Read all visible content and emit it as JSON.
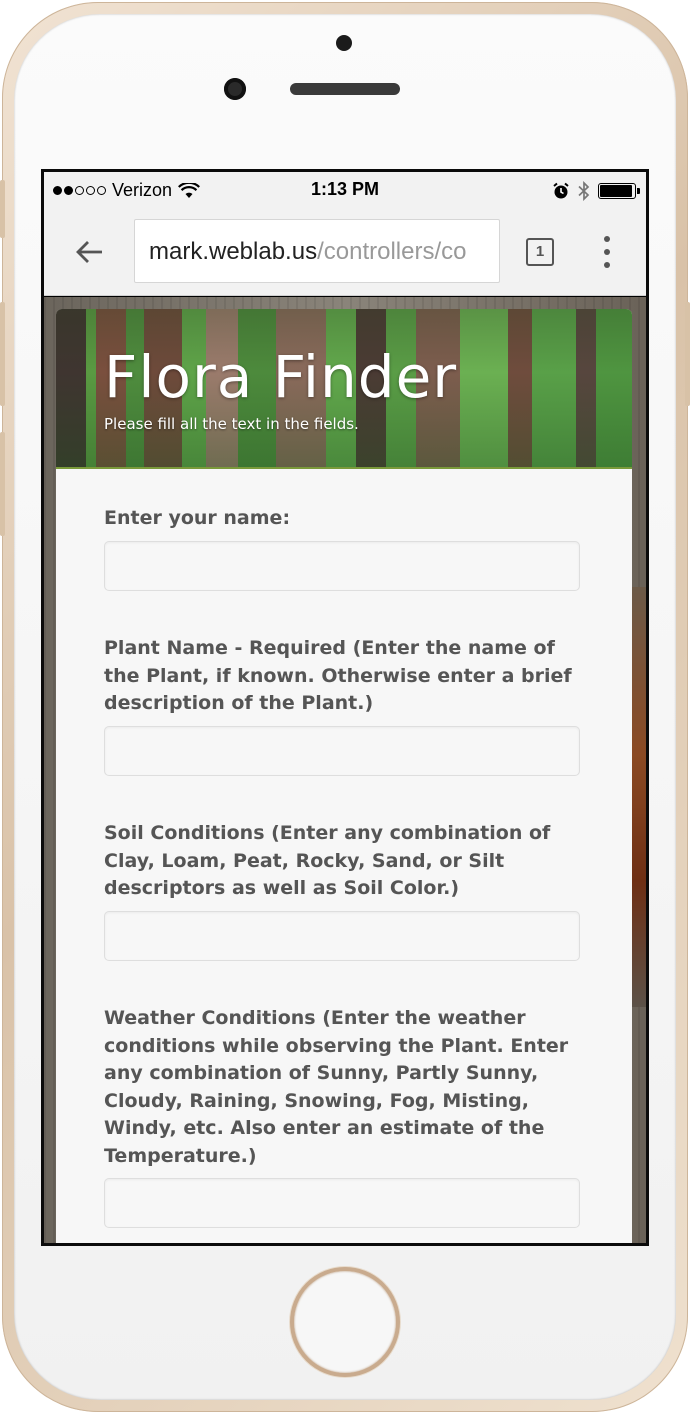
{
  "status_bar": {
    "carrier": "Verizon",
    "signal_bars_filled": 2,
    "signal_bars_total": 5,
    "time": "1:13 PM",
    "battery_level": 0.95
  },
  "browser": {
    "url_host": "mark.weblab.us",
    "url_path": "/controllers/co",
    "tab_count": "1"
  },
  "hero": {
    "title": "Flora Finder",
    "subtitle": "Please fill all the text in the fields."
  },
  "form": {
    "fields": [
      {
        "label": "Enter your name:",
        "value": ""
      },
      {
        "label": "Plant Name - Required (Enter the name of the Plant, if known. Otherwise enter a brief description of the Plant.)",
        "value": ""
      },
      {
        "label": "Soil Conditions (Enter any combination of Clay, Loam, Peat, Rocky, Sand, or Silt descriptors as well as Soil Color.)",
        "value": ""
      },
      {
        "label": "Weather Conditions (Enter the weather conditions while observing the Plant. Enter any combination of Sunny, Partly Sunny, Cloudy, Raining, Snowing, Fog, Misting, Windy, etc. Also enter an estimate of the Temperature.)",
        "value": ""
      }
    ]
  },
  "colors": {
    "label_text": "#555555",
    "hero_accent": "#7a9a3a",
    "phone_frame": "#d9c2a8"
  }
}
